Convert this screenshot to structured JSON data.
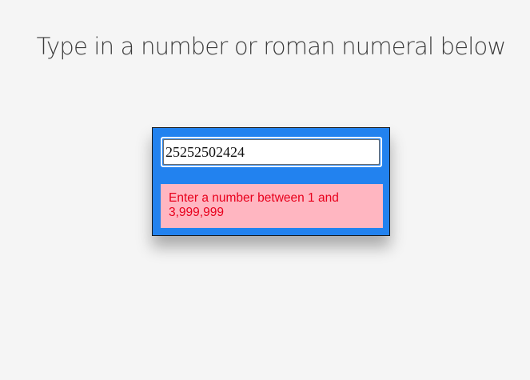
{
  "page": {
    "heading": "Type in a number or roman numeral below"
  },
  "converter": {
    "input_value": "25252502424",
    "error_message": "Enter a number between 1 and 3,999,999"
  },
  "colors": {
    "card_background": "#2282ef",
    "error_background": "#ffb6c1",
    "error_text": "#e8001c"
  }
}
